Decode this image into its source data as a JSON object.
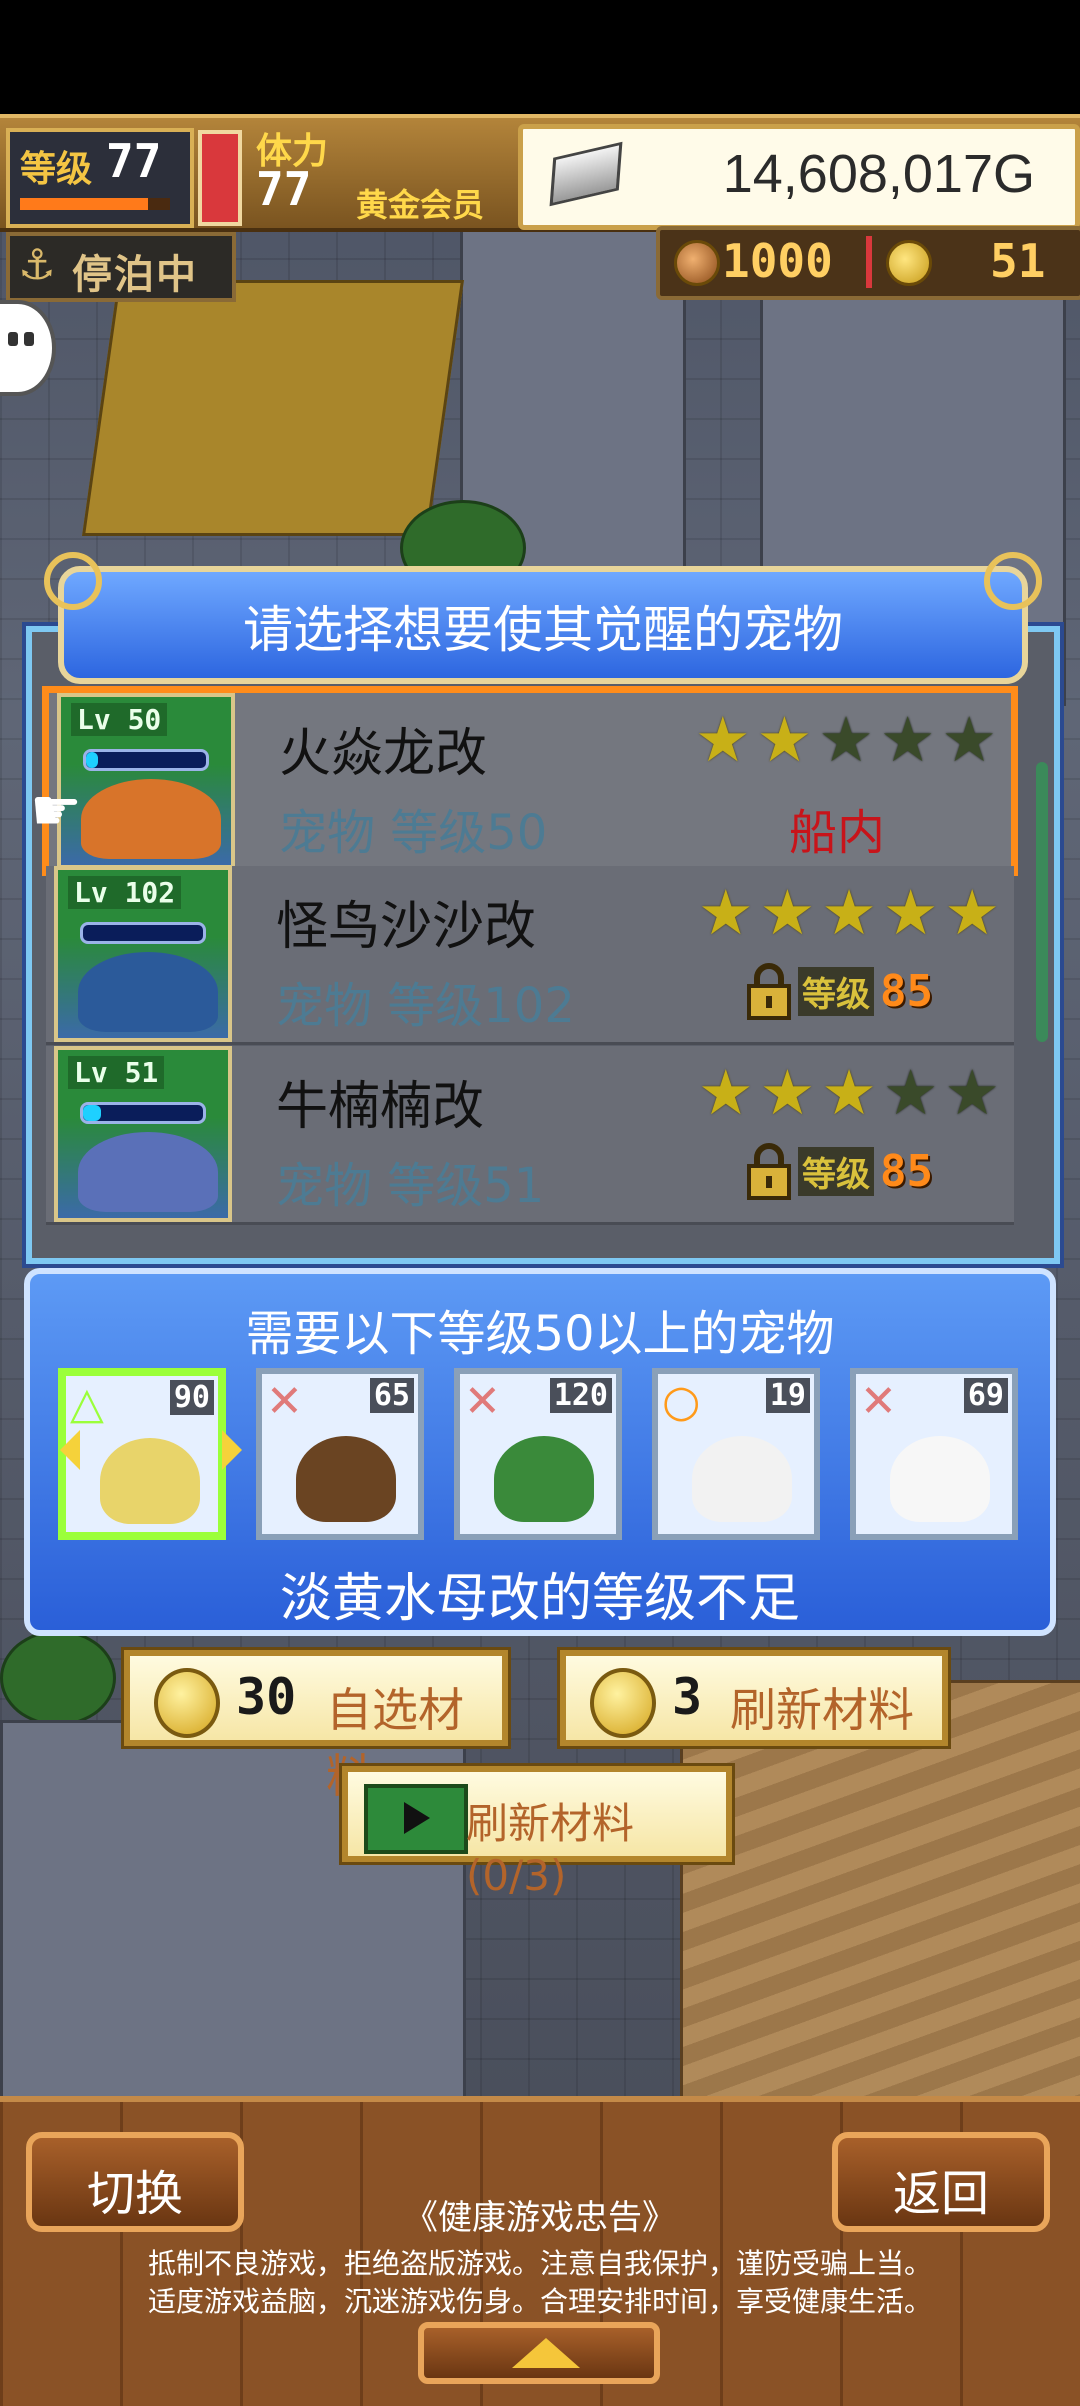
{
  "hud": {
    "level_label": "等级",
    "level_value": "77",
    "level_progress": 0.85,
    "stamina_label": "体力",
    "stamina_value": "77",
    "membership": "黄金会员",
    "gold": "14,608,017G",
    "status_label": "停泊中",
    "resource_a": "1000",
    "resource_b": "51"
  },
  "panel": {
    "title": "请选择想要使其觉醒的宠物",
    "pets": [
      {
        "name": "火焱龙改",
        "sub": "宠物 等级50",
        "lv_badge": "Lv 50",
        "stars_on": 2,
        "stars_total": 5,
        "status": "船内",
        "lock_label": "",
        "lock_level": "",
        "bar_fill": 0.1,
        "color": "#d8742a"
      },
      {
        "name": "怪鸟沙沙改",
        "sub": "宠物 等级102",
        "lv_badge": "Lv 102",
        "stars_on": 5,
        "stars_total": 5,
        "status": "",
        "lock_label": "等级",
        "lock_level": "85",
        "bar_fill": 0.0,
        "color": "#2b5a9a"
      },
      {
        "name": "牛楠楠改",
        "sub": "宠物 等级51",
        "lv_badge": "Lv 51",
        "stars_on": 3,
        "stars_total": 5,
        "status": "",
        "lock_label": "等级",
        "lock_level": "85",
        "bar_fill": 0.15,
        "color": "#5a70b8"
      }
    ]
  },
  "materials": {
    "title": "需要以下等级50以上的宠物",
    "slots": [
      {
        "mark": "△",
        "mark_color": "#9bff3a",
        "level": "90",
        "color": "#e8d46a"
      },
      {
        "mark": "✕",
        "mark_color": "#e07a7a",
        "level": "65",
        "color": "#6a4422"
      },
      {
        "mark": "✕",
        "mark_color": "#e07a7a",
        "level": "120",
        "color": "#3a8a3a"
      },
      {
        "mark": "○",
        "mark_color": "#ff9a1a",
        "level": "19",
        "color": "#f2f2f2"
      },
      {
        "mark": "✕",
        "mark_color": "#e07a7a",
        "level": "69",
        "color": "#f7f7f7"
      }
    ],
    "status": "淡黄水母改的等级不足"
  },
  "actions": {
    "pick_cost": "30",
    "pick_label": "自选材料",
    "refresh_cost": "3",
    "refresh_label": "刷新材料",
    "video_refresh_label": "刷新材料(0/3)"
  },
  "bottom": {
    "switch_label": "切换",
    "back_label": "返回",
    "notice_title": "《健康游戏忠告》",
    "notice_line1": "抵制不良游戏，拒绝盗版游戏。注意自我保护，谨防受骗上当。",
    "notice_line2": "适度游戏益脑，沉迷游戏伤身。合理安排时间，享受健康生活。"
  },
  "icons": {
    "gold": "silver-ingot-icon",
    "anchor": "anchor-icon",
    "coin": "coin-icon",
    "lock": "padlock-icon",
    "video": "video-ad-icon",
    "pointer": "hand-pointer-icon"
  }
}
